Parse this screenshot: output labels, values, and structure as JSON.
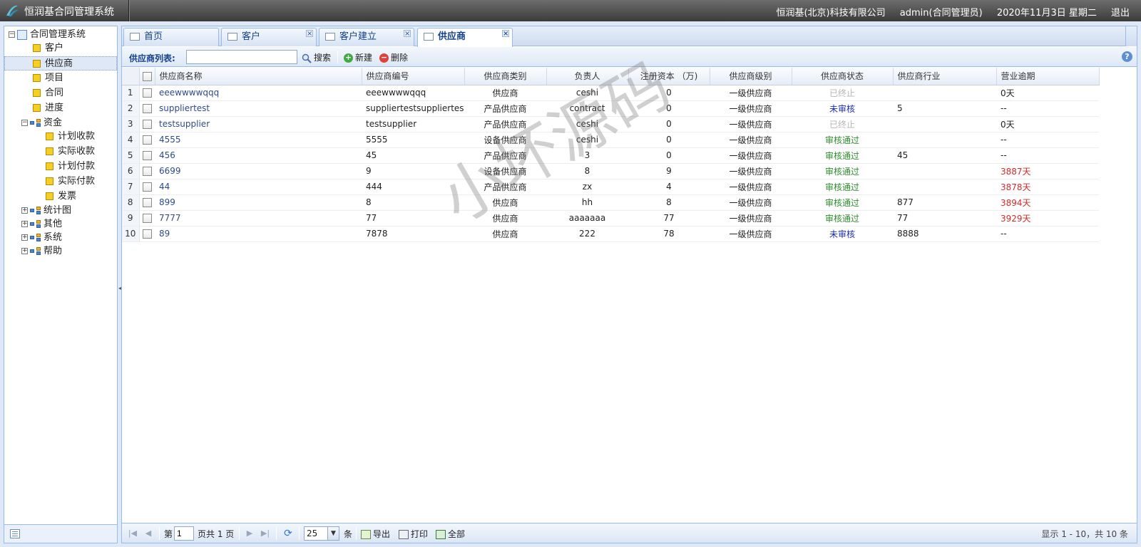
{
  "app": {
    "title": "恒润基合同管理系统",
    "company": "恒润基(北京)科技有限公司",
    "user": "admin(合同管理员)",
    "date": "2020年11月3日 星期二",
    "logout": "退出"
  },
  "sidebar": {
    "root": "合同管理系统",
    "items": [
      {
        "label": "客户"
      },
      {
        "label": "供应商"
      },
      {
        "label": "项目"
      },
      {
        "label": "合同"
      },
      {
        "label": "进度"
      }
    ],
    "funds": {
      "label": "资金",
      "children": [
        "计划收款",
        "实际收款",
        "计划付款",
        "实际付款",
        "发票"
      ]
    },
    "groups": [
      "统计图",
      "其他",
      "系统",
      "帮助"
    ]
  },
  "tabs": [
    {
      "label": "首页"
    },
    {
      "label": "客户"
    },
    {
      "label": "客户建立"
    },
    {
      "label": "供应商"
    }
  ],
  "toolbar": {
    "list_label": "供应商列表:",
    "search_value": "",
    "search": "搜索",
    "new": "新建",
    "delete": "删除"
  },
  "grid": {
    "columns": [
      "供应商名称",
      "供应商编号",
      "供应商类别",
      "负责人",
      "注册资本 （万)",
      "供应商级别",
      "供应商状态",
      "供应商行业",
      "营业逾期"
    ],
    "rows": [
      {
        "n": "1",
        "name": "eeewwwwqqq",
        "code": "eeewwwwqqq",
        "type": "供应商",
        "owner": "ceshi",
        "capital": "0",
        "level": "一级供应商",
        "status": "已终止",
        "status_kind": "end",
        "industry": "",
        "overdue": "0天",
        "overdue_kind": "normal"
      },
      {
        "n": "2",
        "name": "suppliertest",
        "code": "suppliertestsuppliertest",
        "type": "产品供应商",
        "owner": "contract",
        "capital": "0",
        "level": "一级供应商",
        "status": "未审核",
        "status_kind": "pend",
        "industry": "5",
        "overdue": "--",
        "overdue_kind": "normal"
      },
      {
        "n": "3",
        "name": "testsupplier",
        "code": "testsupplier",
        "type": "产品供应商",
        "owner": "ceshi",
        "capital": "0",
        "level": "一级供应商",
        "status": "已终止",
        "status_kind": "end",
        "industry": "",
        "overdue": "0天",
        "overdue_kind": "normal"
      },
      {
        "n": "4",
        "name": "4555",
        "code": "5555",
        "type": "设备供应商",
        "owner": "ceshi",
        "capital": "0",
        "level": "一级供应商",
        "status": "审核通过",
        "status_kind": "ok",
        "industry": "",
        "overdue": "--",
        "overdue_kind": "normal"
      },
      {
        "n": "5",
        "name": "456",
        "code": "45",
        "type": "产品供应商",
        "owner": "3",
        "capital": "0",
        "level": "一级供应商",
        "status": "审核通过",
        "status_kind": "ok",
        "industry": "45",
        "overdue": "--",
        "overdue_kind": "normal"
      },
      {
        "n": "6",
        "name": "6699",
        "code": "9",
        "type": "设备供应商",
        "owner": "8",
        "capital": "9",
        "level": "一级供应商",
        "status": "审核通过",
        "status_kind": "ok",
        "industry": "",
        "overdue": "3887天",
        "overdue_kind": "red"
      },
      {
        "n": "7",
        "name": "44",
        "code": "444",
        "type": "产品供应商",
        "owner": "zx",
        "capital": "4",
        "level": "一级供应商",
        "status": "审核通过",
        "status_kind": "ok",
        "industry": "",
        "overdue": "3878天",
        "overdue_kind": "red"
      },
      {
        "n": "8",
        "name": "899",
        "code": "8",
        "type": "供应商",
        "owner": "hh",
        "capital": "8",
        "level": "一级供应商",
        "status": "审核通过",
        "status_kind": "ok",
        "industry": "877",
        "overdue": "3894天",
        "overdue_kind": "red"
      },
      {
        "n": "9",
        "name": "7777",
        "code": "77",
        "type": "供应商",
        "owner": "aaaaaaa",
        "capital": "77",
        "level": "一级供应商",
        "status": "审核通过",
        "status_kind": "ok",
        "industry": "77",
        "overdue": "3929天",
        "overdue_kind": "red"
      },
      {
        "n": "10",
        "name": "89",
        "code": "7878",
        "type": "供应商",
        "owner": "222",
        "capital": "78",
        "level": "一级供应商",
        "status": "未审核",
        "status_kind": "pend",
        "industry": "8888",
        "overdue": "--",
        "overdue_kind": "normal"
      }
    ]
  },
  "pager": {
    "page_prefix": "第",
    "page_value": "1",
    "page_suffix": "页共 1 页",
    "page_size": "25",
    "per_unit": "条",
    "export": "导出",
    "print": "打印",
    "all": "全部",
    "info": "显示 1 - 10，共 10 条"
  },
  "watermark": "小坏源码",
  "colors": {
    "status_ok": "#2e8b2e",
    "status_pending": "#1c2fa8",
    "status_ended": "#b5b5b5",
    "overdue": "#d42b2b",
    "link": "#2f4b8a"
  }
}
